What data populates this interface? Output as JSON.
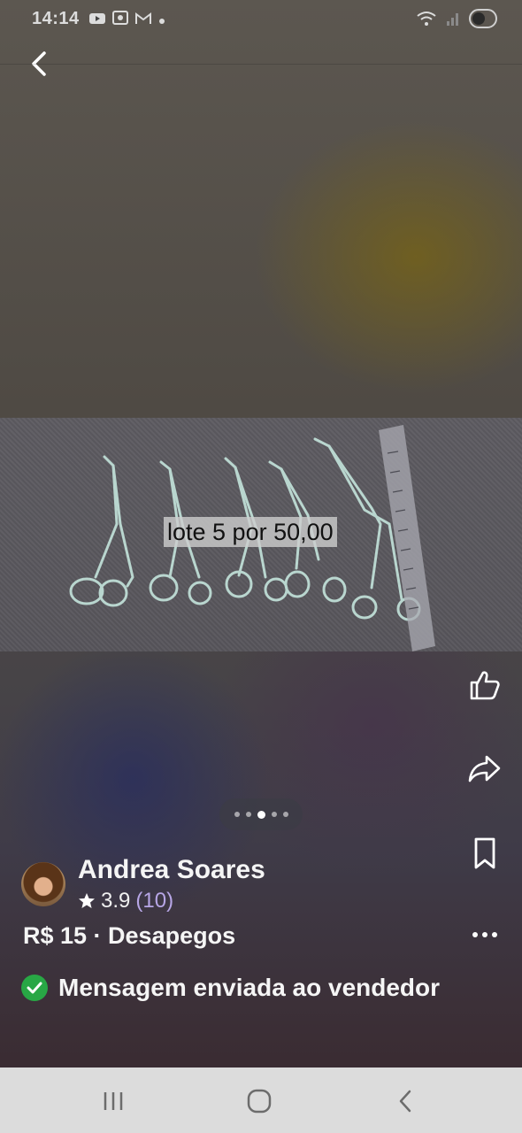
{
  "status_bar": {
    "time": "14:14",
    "left_icons": [
      "youtube-icon",
      "screenshot-icon",
      "gmail-icon",
      "notification-dot-icon"
    ],
    "right_icons": [
      "wifi-icon",
      "signal-icon",
      "battery-icon"
    ]
  },
  "header": {
    "back_icon": "chevron-left-icon"
  },
  "photo": {
    "caption": "lote 5 por 50,00"
  },
  "actions": [
    {
      "name": "like-button",
      "icon": "thumbs-up-icon"
    },
    {
      "name": "share-button",
      "icon": "share-arrow-icon"
    },
    {
      "name": "save-button",
      "icon": "bookmark-icon"
    },
    {
      "name": "more-button",
      "icon": "more-dots-icon"
    }
  ],
  "pager": {
    "total": 5,
    "active_index": 2
  },
  "seller": {
    "name": "Andrea Soares",
    "rating": "3.9",
    "rating_count": "(10)"
  },
  "listing": {
    "price_line": "R$ 15 · Desapegos"
  },
  "status": {
    "message": "Mensagem enviada ao vendedor"
  },
  "nav_bar": {
    "buttons": [
      "recent-apps-icon",
      "home-icon",
      "back-icon"
    ]
  },
  "colors": {
    "accent_green": "#28a745",
    "rating_count": "#b7a6e6"
  }
}
